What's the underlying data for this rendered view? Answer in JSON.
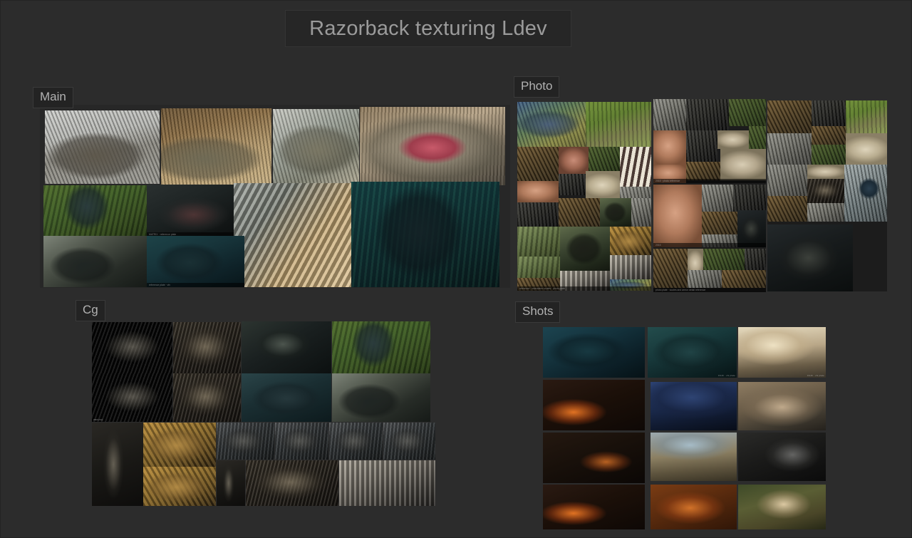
{
  "board": {
    "title": "Razorback texturing Ldev",
    "background_color": "#2c2c2c",
    "title_box_color": "#262626",
    "label_box_color": "#232323",
    "label_text_color": "#b2b2b2"
  },
  "sections": [
    {
      "id": "main",
      "label": "Main",
      "image_count": 8
    },
    {
      "id": "photo",
      "label": "Photo",
      "image_count": 52
    },
    {
      "id": "cg",
      "label": "Cg",
      "image_count": 19
    },
    {
      "id": "shots",
      "label": "Shots",
      "image_count": 12
    }
  ],
  "main": {
    "label": "Main",
    "images": [
      {
        "name": "crocodile-on-stone-paving"
      },
      {
        "name": "crocodile-resting-on-sand"
      },
      {
        "name": "crocodile-head-open-jaw"
      },
      {
        "name": "crocodile-roaring-wide-open-mouth"
      },
      {
        "name": "raptor-standing-in-grass"
      },
      {
        "name": "raptor-climbing-into-vehicle"
      },
      {
        "name": "raptor-head-through-bus-window"
      },
      {
        "name": "raptor-in-blue-jungle-light"
      },
      {
        "name": "crocodile-tail-scutes-closeup"
      },
      {
        "name": "blue-raptor-roaring-in-field"
      }
    ]
  },
  "photo": {
    "label": "Photo",
    "groups": [
      {
        "name": "photo-group-left",
        "images": 18
      },
      {
        "name": "photo-group-middle",
        "images": 19
      },
      {
        "name": "photo-group-right",
        "images": 15
      }
    ],
    "subjects": [
      "blue-caiman-head",
      "caiman-in-grass",
      "crocodile-scale-macro",
      "lizard-belly-skin",
      "keeper-handling-croc",
      "croc-foot-claws",
      "stegosaurus-model",
      "marine-iguana",
      "turtle-shell",
      "armadillo-lizard",
      "croc-osteoderms",
      "albino-alligator",
      "monitor-lizard-eye",
      "croc-jaw-teeth",
      "black-caiman-portrait"
    ]
  },
  "cg": {
    "label": "Cg",
    "images": [
      {
        "name": "zbrush-sculpt-scale-patch-front"
      },
      {
        "name": "zbrush-sculpt-scale-patch-side"
      },
      {
        "name": "cg-creature-head-spiked"
      },
      {
        "name": "cg-creature-head-roaring"
      },
      {
        "name": "cg-creature-underwater-cave"
      },
      {
        "name": "cg-raptor-blue-head-profile"
      },
      {
        "name": "cg-raptor-in-grass"
      },
      {
        "name": "cg-raptor-in-vehicle-window"
      },
      {
        "name": "cg-hide-displacement-closeup"
      },
      {
        "name": "tortoise-head-reference"
      },
      {
        "name": "tortoise-full-body-reference"
      },
      {
        "name": "cg-head-turnaround-01"
      },
      {
        "name": "cg-head-turnaround-02"
      },
      {
        "name": "cg-head-turnaround-03"
      },
      {
        "name": "cg-head-turnaround-04"
      },
      {
        "name": "cg-limb-claw-render"
      },
      {
        "name": "cg-creature-body-render"
      },
      {
        "name": "cg-creature-back-spine-render"
      }
    ]
  },
  "shots": {
    "label": "Shots",
    "rows": 4,
    "columns": 3,
    "images": [
      {
        "name": "shot-dino-amber-interior"
      },
      {
        "name": "shot-dino-teal-jungle"
      },
      {
        "name": "shot-dino-sunset-roar"
      },
      {
        "name": "shot-dino-fire-night"
      },
      {
        "name": "shot-lion-night-cliff"
      },
      {
        "name": "shot-lion-dust-walk"
      },
      {
        "name": "shot-dino-embers-prowl"
      },
      {
        "name": "shot-lion-savanna-gorge"
      },
      {
        "name": "shot-lion-cave-silhouette"
      },
      {
        "name": "shot-dino-burning-ruins"
      },
      {
        "name": "shot-lion-fire-smoke"
      },
      {
        "name": "shot-lion-daylight-portrait"
      }
    ]
  }
}
